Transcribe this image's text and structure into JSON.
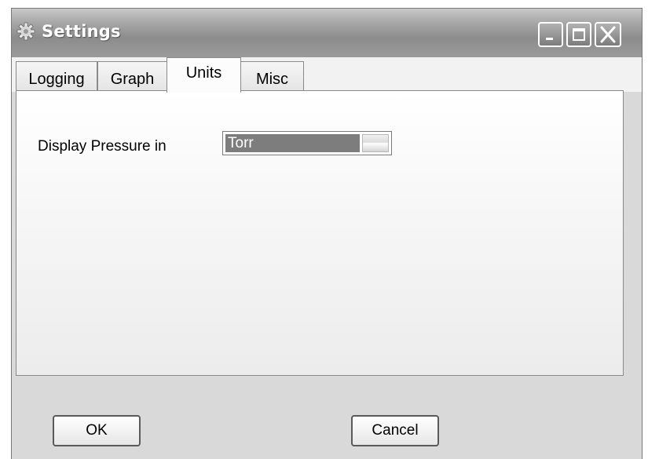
{
  "window": {
    "title": "Settings",
    "title_icon": "gear-icon"
  },
  "controls": {
    "minimize_icon": "minimize-icon",
    "maximize_icon": "maximize-icon",
    "close_icon": "close-icon"
  },
  "tabs": [
    {
      "label": "Logging",
      "active": false
    },
    {
      "label": "Graph",
      "active": false
    },
    {
      "label": "Units",
      "active": true
    },
    {
      "label": "Misc",
      "active": false
    }
  ],
  "units": {
    "pressure_label": "Display Pressure in",
    "pressure_value": "Torr"
  },
  "buttons": {
    "ok": "OK",
    "cancel": "Cancel"
  }
}
